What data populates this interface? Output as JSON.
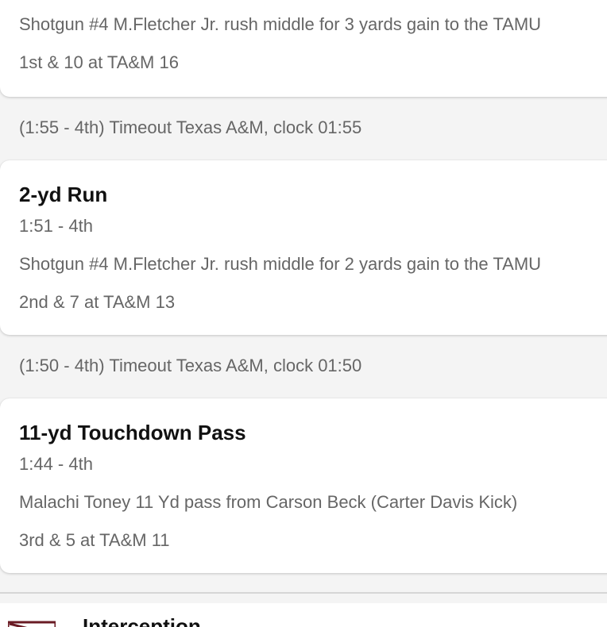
{
  "plays": [
    {
      "description": "Shotgun #4 M.Fletcher Jr. rush middle for 3 yards gain to the TAMU",
      "down_distance": "1st & 10 at TA&M 16"
    },
    {
      "title": "2-yd Run",
      "time": "1:51 - 4th",
      "description": "Shotgun #4 M.Fletcher Jr. rush middle for 2 yards gain to the TAMU",
      "down_distance": "2nd & 7 at TA&M 13"
    },
    {
      "title": "11-yd Touchdown Pass",
      "time": "1:44 - 4th",
      "description": "Malachi Toney 11 Yd pass from Carson Beck (Carter Davis Kick)",
      "down_distance": "3rd & 5 at TA&M 11"
    }
  ],
  "timeouts": [
    "(1:55 - 4th) Timeout Texas A&M, clock 01:55",
    "(1:50 - 4th) Timeout Texas A&M, clock 01:50"
  ],
  "next_item": {
    "title": "Interception",
    "logo_icon": "team-logo-icon",
    "logo_color": "#6a1b24"
  }
}
